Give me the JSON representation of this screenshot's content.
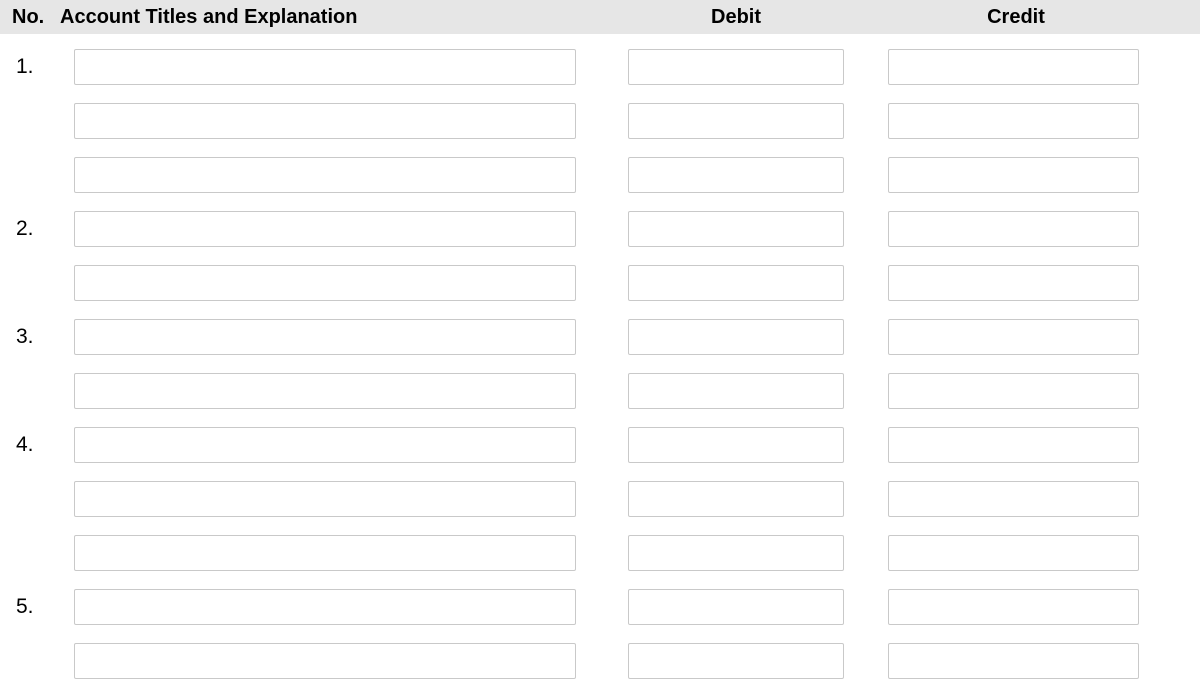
{
  "header": {
    "no": "No.",
    "account": "Account Titles and Explanation",
    "debit": "Debit",
    "credit": "Credit"
  },
  "rows": [
    {
      "no": "1.",
      "account": "",
      "debit": "",
      "credit": ""
    },
    {
      "no": "",
      "account": "",
      "debit": "",
      "credit": ""
    },
    {
      "no": "",
      "account": "",
      "debit": "",
      "credit": ""
    },
    {
      "no": "2.",
      "account": "",
      "debit": "",
      "credit": ""
    },
    {
      "no": "",
      "account": "",
      "debit": "",
      "credit": ""
    },
    {
      "no": "3.",
      "account": "",
      "debit": "",
      "credit": ""
    },
    {
      "no": "",
      "account": "",
      "debit": "",
      "credit": ""
    },
    {
      "no": "4.",
      "account": "",
      "debit": "",
      "credit": ""
    },
    {
      "no": "",
      "account": "",
      "debit": "",
      "credit": ""
    },
    {
      "no": "",
      "account": "",
      "debit": "",
      "credit": ""
    },
    {
      "no": "5.",
      "account": "",
      "debit": "",
      "credit": ""
    },
    {
      "no": "",
      "account": "",
      "debit": "",
      "credit": ""
    }
  ]
}
